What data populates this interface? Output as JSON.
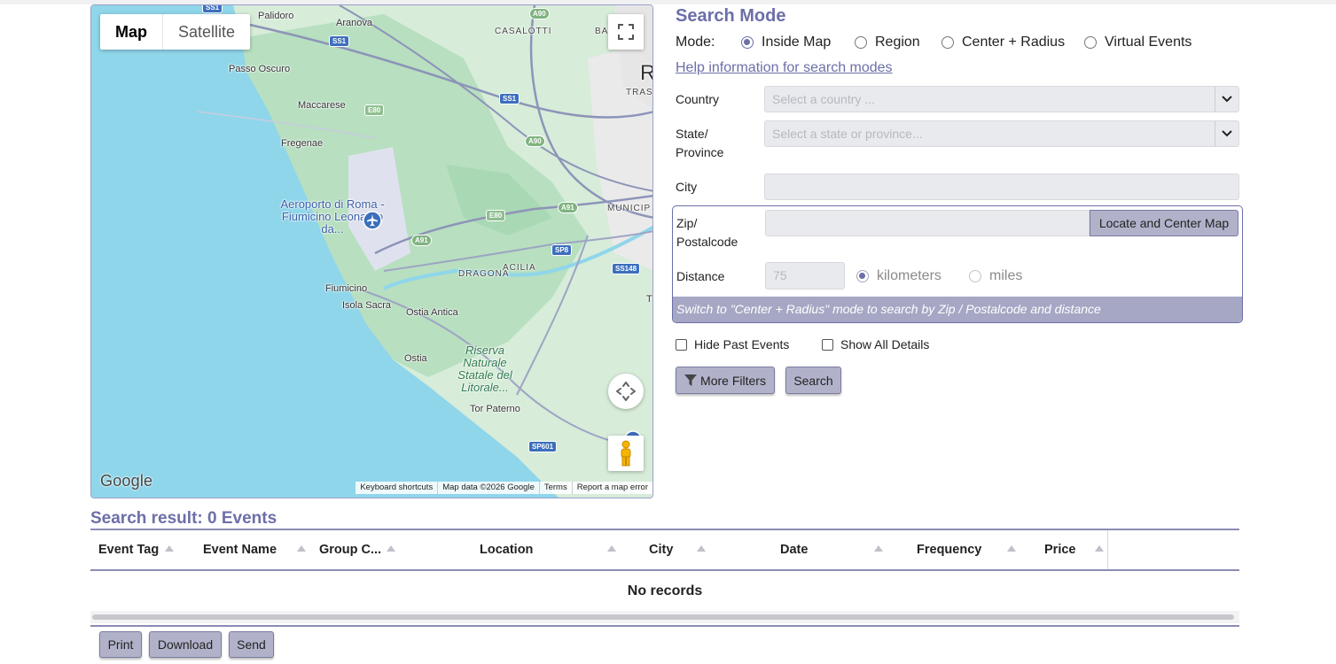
{
  "map": {
    "toggle": {
      "map_label": "Map",
      "satellite_label": "Satellite"
    },
    "labels": {
      "palidoro": "Palidoro",
      "aranova": "Aranova",
      "casalotti": "CASALOTTI",
      "passo_oscuro": "Passo Oscuro",
      "maccarese": "Maccarese",
      "fregenae": "Fregenae",
      "airport": "Aeroporto di Roma - Fiumicino Leonardo da...",
      "municipio": "MUNICIP",
      "dragona": "DRAGONA",
      "acilia": "ACILIA",
      "fiumicino": "Fiumicino",
      "isola_sacra": "Isola Sacra",
      "ostia_antica": "Ostia Antica",
      "ostia": "Ostia",
      "riserva": "Riserva Naturale Statale del Litorale...",
      "tor_paterno": "Tor Paterno",
      "trast": "TRAST",
      "ba": "BA",
      "r": "R",
      "t": "T"
    },
    "shields": {
      "ss1_top": "SS1",
      "ss1_mid": "SS1",
      "a90_top": "A90",
      "a90_mid": "A90",
      "e80_top": "E80",
      "e80_mid": "E80",
      "a91_a": "A91",
      "a91_b": "A91",
      "sp8": "SP8",
      "ss148": "SS148",
      "sp601": "SP601"
    },
    "google_logo": "Google",
    "attribution": {
      "keyboard": "Keyboard shortcuts",
      "data": "Map data ©2026 Google",
      "terms": "Terms",
      "report": "Report a map error"
    },
    "colors": {
      "water": "#8fd6ea",
      "land": "#d7ecd9",
      "green": "#b7dfc0"
    }
  },
  "search_mode": {
    "title": "Search Mode",
    "mode_label": "Mode:",
    "options": [
      "Inside Map",
      "Region",
      "Center + Radius",
      "Virtual Events"
    ],
    "selected": "Inside Map",
    "help_link": "Help information for search modes"
  },
  "form": {
    "country_label": "Country",
    "country_placeholder": "Select a country ...",
    "state_label_1": "State/",
    "state_label_2": "Province",
    "state_placeholder": "Select a state or province...",
    "city_label": "City",
    "zip_label_1": "Zip/",
    "zip_label_2": "Postalcode",
    "locate_button": "Locate and Center Map",
    "distance_label": "Distance",
    "distance_value": "75",
    "unit_km": "kilometers",
    "unit_miles": "miles",
    "notice": "Switch to \"Center + Radius\" mode to search by Zip / Postalcode and distance",
    "hide_past": "Hide Past Events",
    "show_all": "Show All Details",
    "more_filters": "More Filters",
    "search_button": "Search"
  },
  "results": {
    "title": "Search result: 0 Events",
    "columns": [
      "Event Tag",
      "Event Name",
      "Group C...",
      "Location",
      "City",
      "Date",
      "Frequency",
      "Price"
    ],
    "empty": "No records",
    "actions": {
      "print": "Print",
      "download": "Download",
      "send": "Send"
    }
  },
  "colors": {
    "accent": "#6c6fa8",
    "button_bg": "#b1b2ca",
    "notice_bg": "#a6a7c4"
  }
}
